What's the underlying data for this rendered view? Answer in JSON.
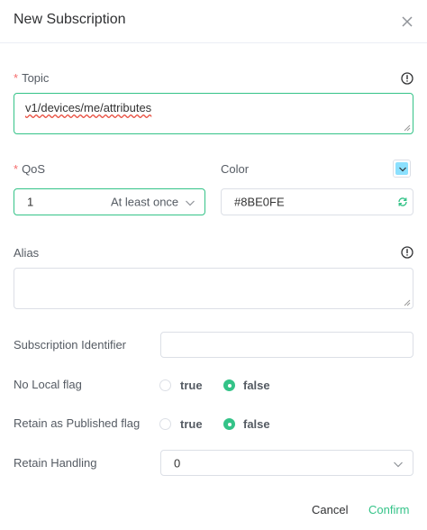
{
  "dialog": {
    "title": "New Subscription"
  },
  "topic": {
    "label": "Topic",
    "value": "v1/devices/me/attributes"
  },
  "qos": {
    "label": "QoS",
    "value": "1",
    "description": "At least once"
  },
  "color": {
    "label": "Color",
    "value": "#8BE0FE",
    "swatch": "#8BE0FE"
  },
  "alias": {
    "label": "Alias",
    "value": ""
  },
  "subscription_identifier": {
    "label": "Subscription Identifier",
    "value": ""
  },
  "no_local": {
    "label": "No Local flag",
    "options": [
      "true",
      "false"
    ],
    "selected": "false"
  },
  "retain_as_published": {
    "label": "Retain as Published flag",
    "options": [
      "true",
      "false"
    ],
    "selected": "false"
  },
  "retain_handling": {
    "label": "Retain Handling",
    "value": "0"
  },
  "footer": {
    "cancel": "Cancel",
    "confirm": "Confirm"
  },
  "colors": {
    "accent": "#34c388",
    "required": "#f56c6c",
    "border": "#dcdfe6"
  }
}
